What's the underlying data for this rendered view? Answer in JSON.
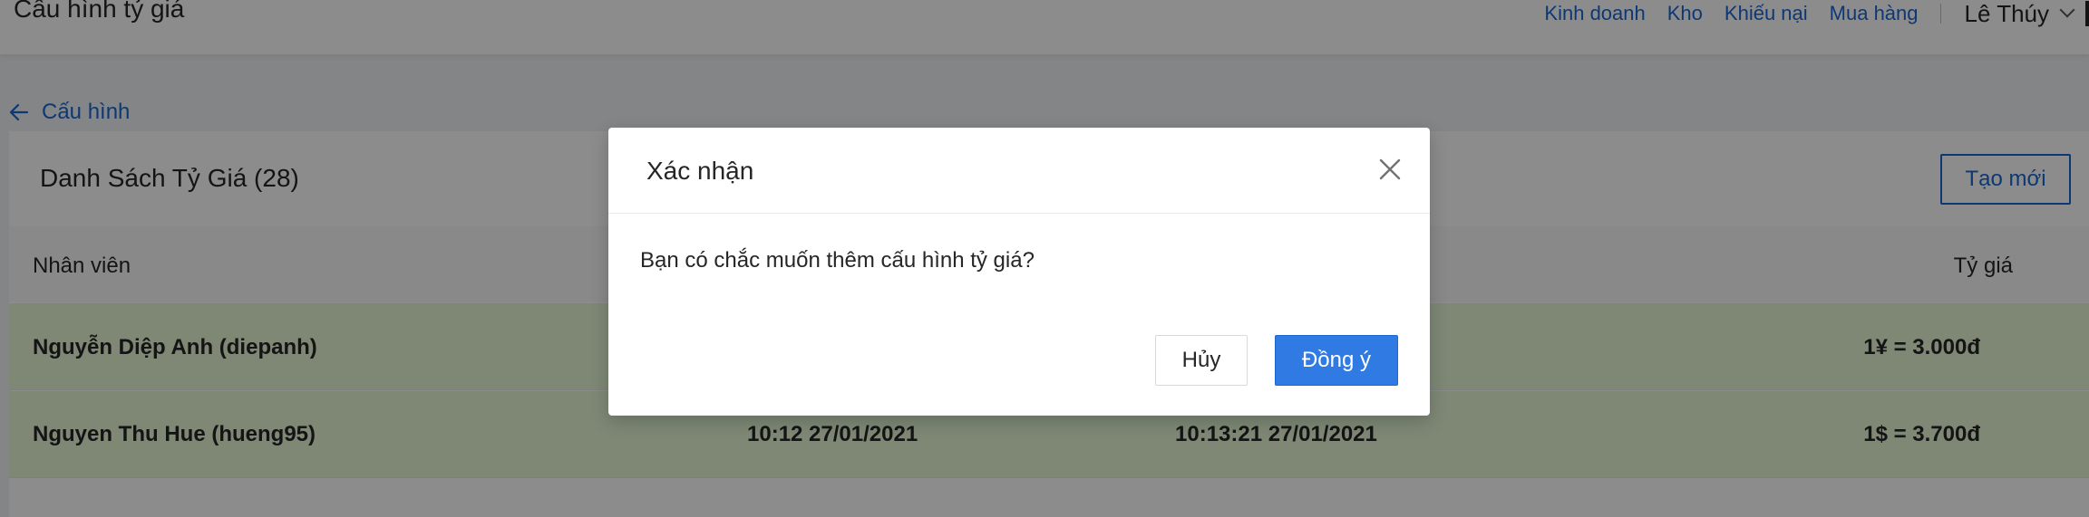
{
  "header": {
    "page_title": "Cấu hình tỷ giá",
    "nav": [
      "Kinh doanh",
      "Kho",
      "Khiếu nại",
      "Mua hàng"
    ],
    "user_name": "Lê Thúy"
  },
  "breadcrumb": {
    "back_label": "Cấu hình"
  },
  "list": {
    "title": "Danh Sách Tỷ Giá (28)",
    "create_label": "Tạo mới",
    "columns": {
      "staff": "Nhân viên",
      "rate": "Tỷ giá"
    },
    "rows": [
      {
        "staff": "Nguyễn Diệp Anh (diepanh)",
        "time1": "",
        "time2": "",
        "rate": "1¥ = 3.000đ"
      },
      {
        "staff": "Nguyen Thu Hue (hueng95)",
        "time1": "10:12 27/01/2021",
        "time2": "10:13:21 27/01/2021",
        "rate": "1$ = 3.700đ"
      }
    ]
  },
  "modal": {
    "title": "Xác nhận",
    "message": "Bạn có chắc muốn thêm cấu hình tỷ giá?",
    "cancel_label": "Hủy",
    "ok_label": "Đồng ý"
  },
  "colors": {
    "accent": "#1a66d1",
    "primary_button": "#2f7be3",
    "highlight_row": "#e6f7d5"
  }
}
